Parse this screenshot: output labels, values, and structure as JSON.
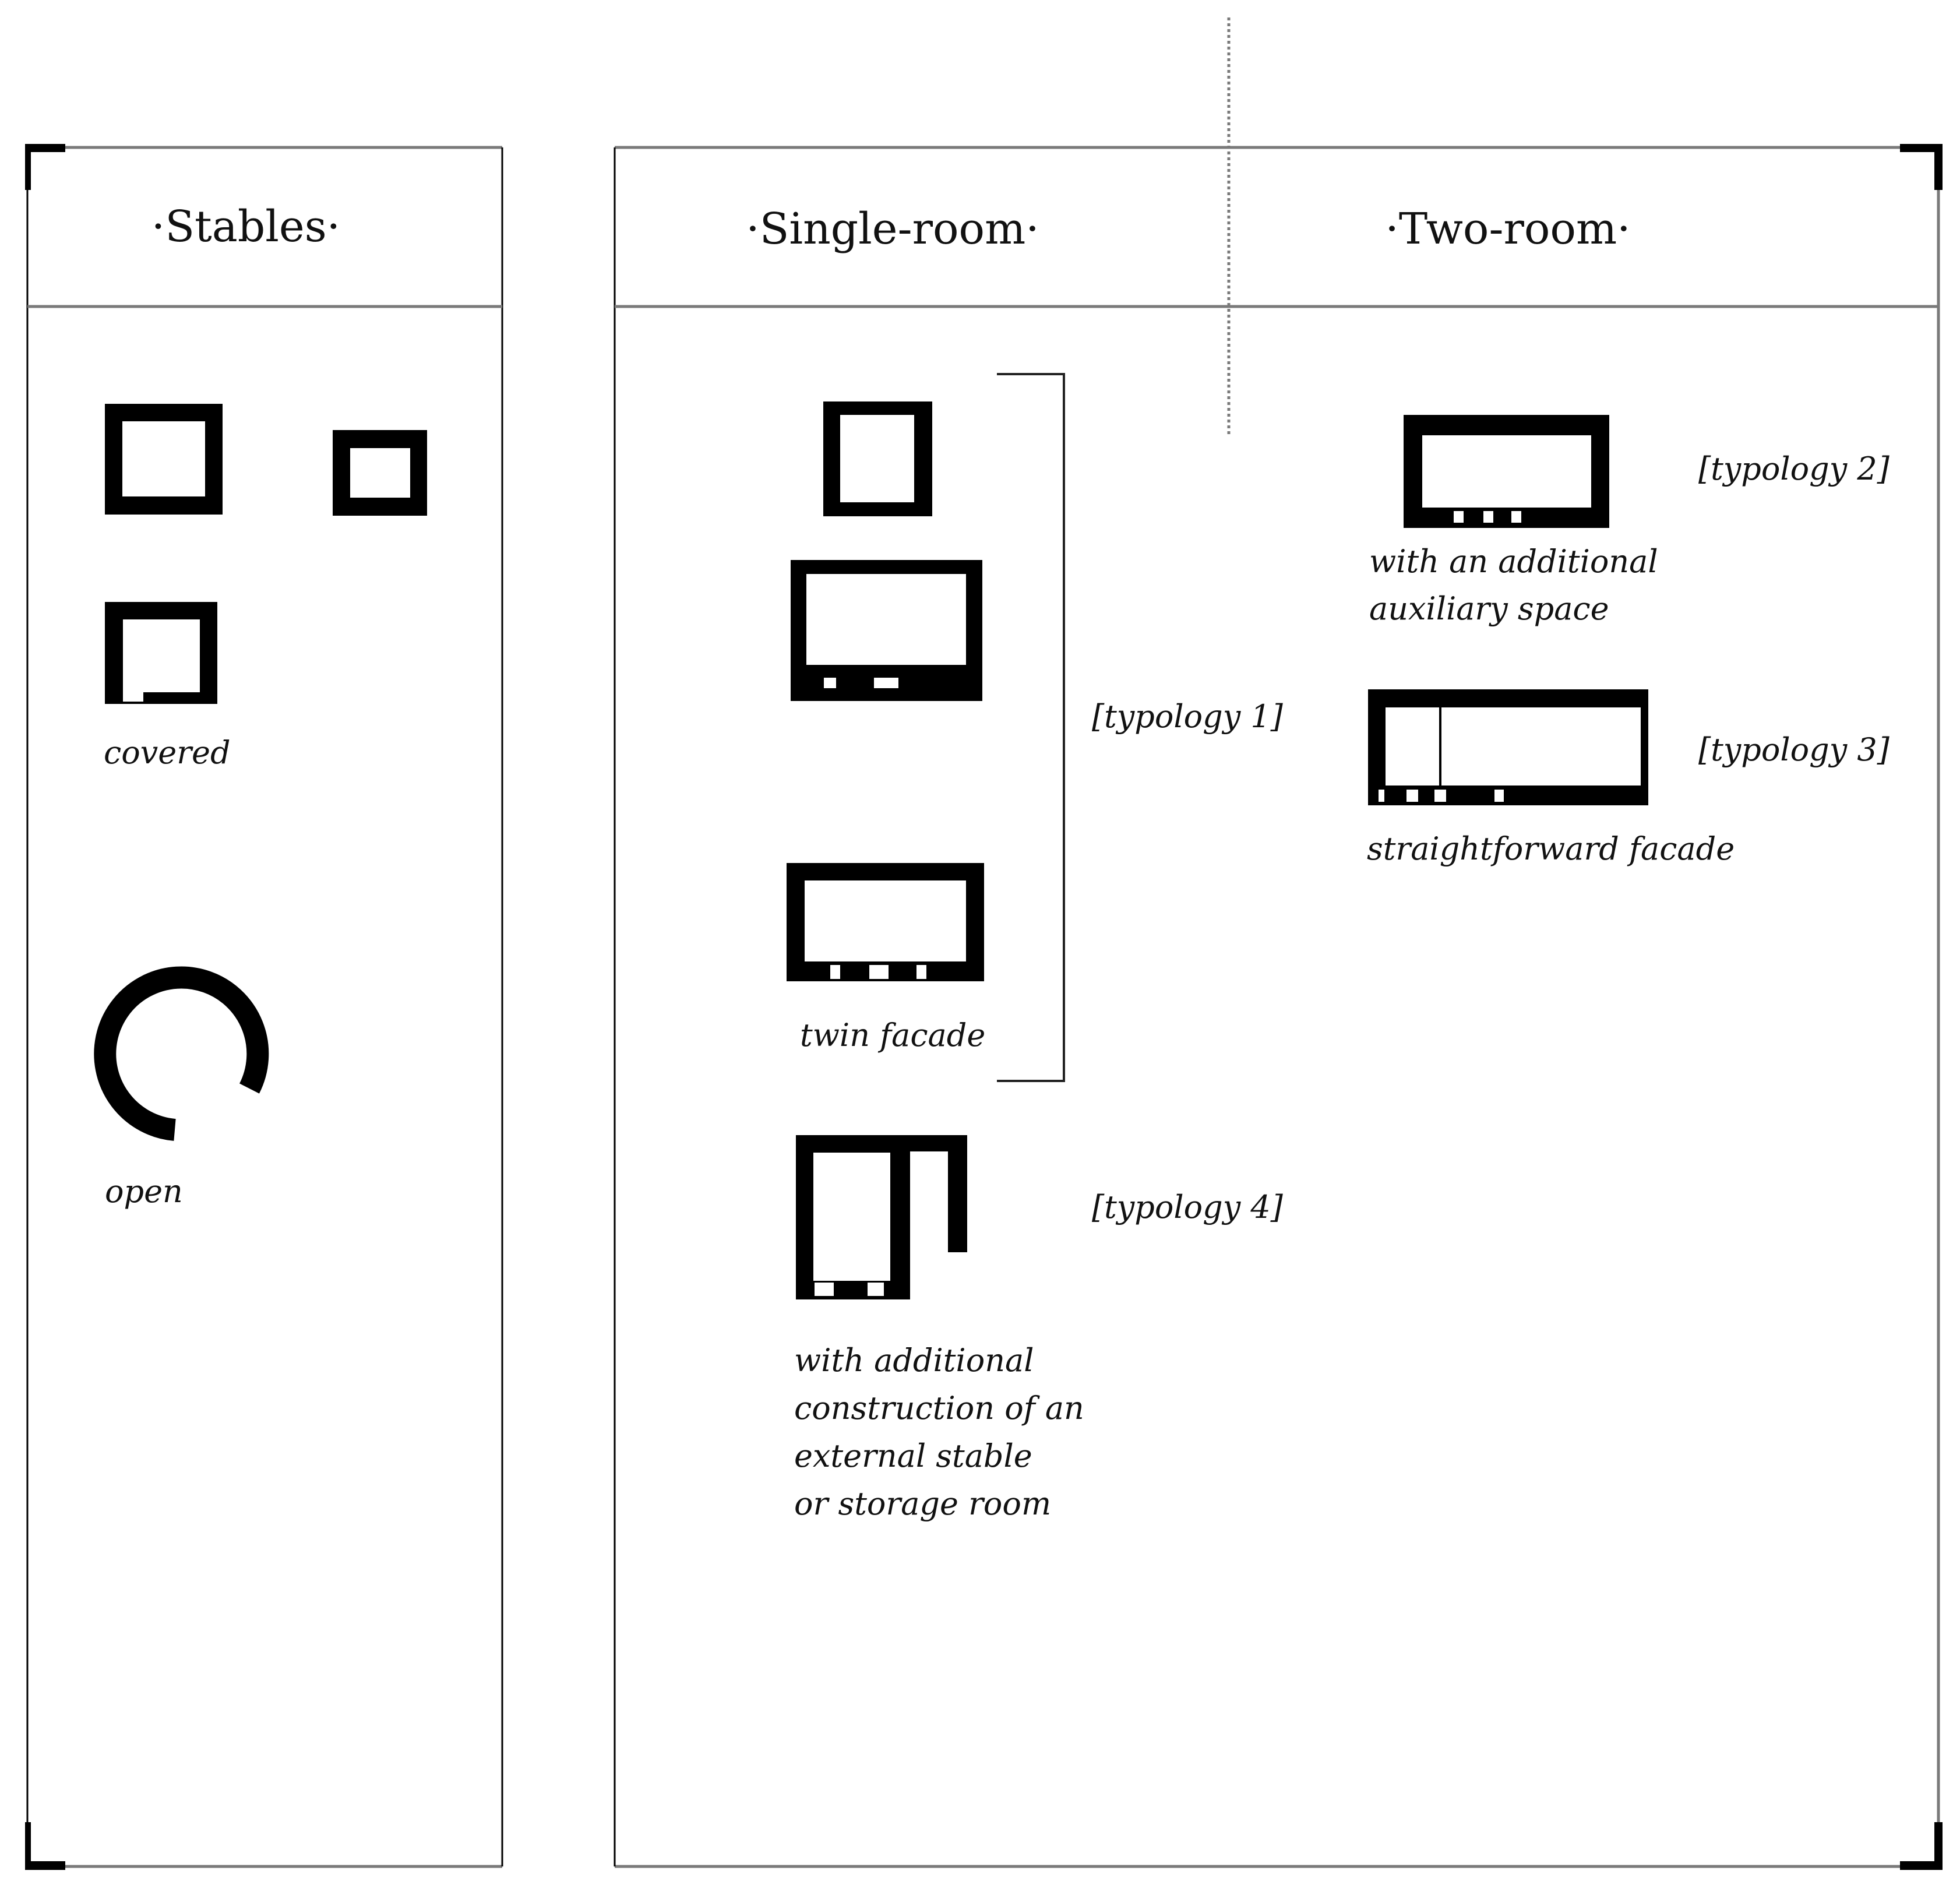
{
  "diagram": {
    "sections": {
      "stables": {
        "title": "·Stables·"
      },
      "single_room": {
        "title": "·Single-room·"
      },
      "two_room": {
        "title": "·Two-room·"
      }
    },
    "stables": {
      "covered_label": "covered",
      "open_label": "open",
      "covered_variants": [
        "square stable",
        "small rectangular stable",
        "stable with door"
      ],
      "open_variants": [
        "circular open stable"
      ]
    },
    "single_room": {
      "typology_1": {
        "tag": "[typology 1]",
        "variants": [
          "single door",
          "two openings",
          "three openings"
        ],
        "caption": "twin facade"
      },
      "typology_4": {
        "tag": "[typology 4]",
        "caption_lines": [
          "with additional",
          "construction of an",
          "external stable",
          "or storage room"
        ]
      }
    },
    "two_room": {
      "typology_2": {
        "tag": "[typology 2]",
        "caption_lines": [
          "with an additional",
          "auxiliary space"
        ]
      },
      "typology_3": {
        "tag": "[typology 3]",
        "caption": "straightforward facade"
      }
    },
    "colors": {
      "wall": "#000000",
      "frame_line": "#7a7a7a",
      "background": "#ffffff"
    }
  }
}
